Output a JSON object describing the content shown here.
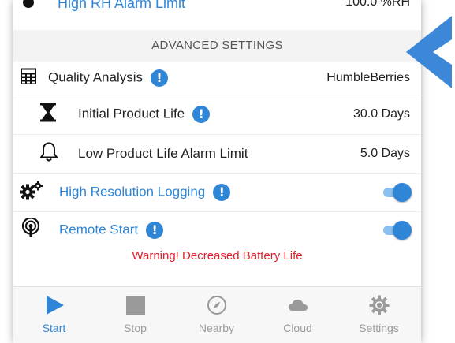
{
  "colors": {
    "accent": "#2f86d6",
    "warning": "#e0202b",
    "header_bg": "#f3f3f3"
  },
  "top_row": {
    "label": "High RH Alarm Limit",
    "value": "100.0 %RH"
  },
  "section": {
    "title": "ADVANCED SETTINGS"
  },
  "rows": {
    "quality": {
      "label": "Quality Analysis",
      "value": "HumbleBerries",
      "icon": "calculator-icon"
    },
    "initial_life": {
      "label": "Initial Product Life",
      "value": "30.0 Days",
      "icon": "hourglass-icon"
    },
    "low_life": {
      "label": "Low Product Life Alarm Limit",
      "value": "5.0 Days",
      "icon": "bell-icon"
    },
    "hi_res": {
      "label": "High Resolution Logging",
      "enabled": true,
      "icon": "gears-icon"
    },
    "remote": {
      "label": "Remote Start",
      "enabled": true,
      "icon": "broadcast-icon"
    }
  },
  "info_glyph": "!",
  "warning_text": "Warning! Decreased Battery Life",
  "nav": {
    "items": [
      {
        "label": "Start",
        "icon": "play-icon",
        "active": true
      },
      {
        "label": "Stop",
        "icon": "stop-icon",
        "active": false
      },
      {
        "label": "Nearby",
        "icon": "compass-icon",
        "active": false
      },
      {
        "label": "Cloud",
        "icon": "cloud-icon",
        "active": false
      },
      {
        "label": "Settings",
        "icon": "gear-icon",
        "active": false
      }
    ]
  }
}
